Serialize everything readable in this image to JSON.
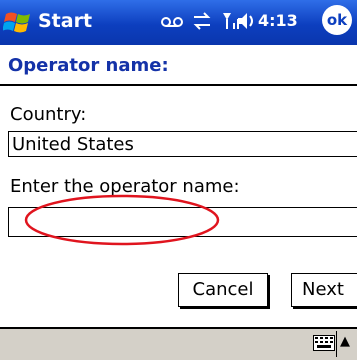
{
  "taskbar": {
    "start_label": "Start",
    "time": "4:13",
    "ok_label": "ok",
    "icons": [
      "voicemail-icon",
      "connectivity-icon",
      "signal-icon",
      "volume-icon"
    ]
  },
  "page": {
    "title": "Operator name:"
  },
  "form": {
    "country_label": "Country:",
    "country_value": "United States",
    "operator_label": "Enter the operator name:",
    "operator_value": ""
  },
  "buttons": {
    "cancel_label": "Cancel",
    "next_label": "Next"
  },
  "bottom_bar": {
    "icons": [
      "keyboard-icon",
      "sip-arrow-icon"
    ]
  },
  "colors": {
    "taskbar": "#0d3fbf",
    "title": "#1432a8",
    "annotation": "#e0141e"
  }
}
